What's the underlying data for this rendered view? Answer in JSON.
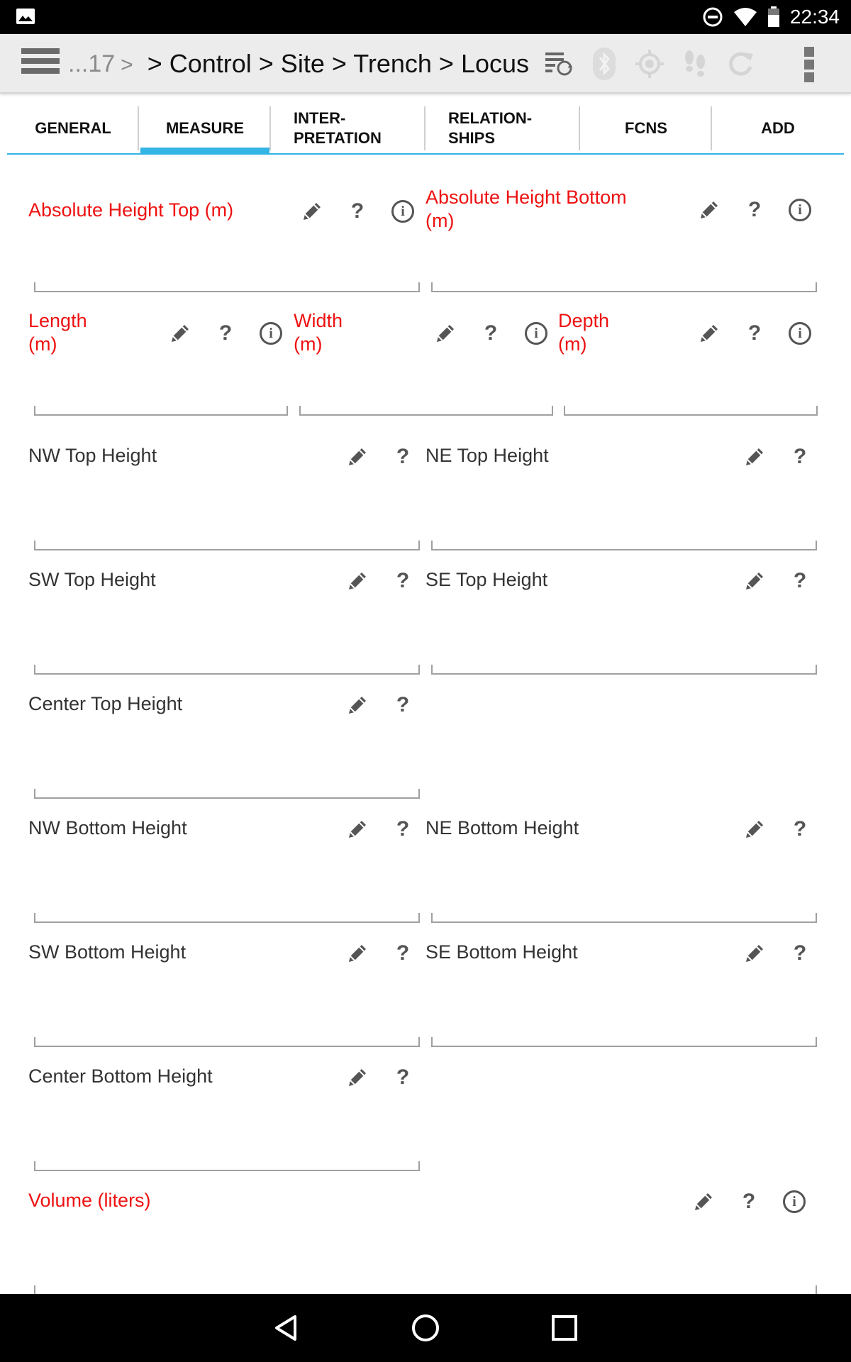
{
  "status_bar": {
    "time": "22:34",
    "icons": [
      "image-icon",
      "do-not-disturb-icon",
      "wifi-icon",
      "battery-icon"
    ]
  },
  "action_bar": {
    "breadcrumb_prefix": "...17",
    "breadcrumb_prefix_sep": ">",
    "breadcrumb_path": "> Control > Site > Trench > Locus",
    "icons": [
      "sync-list-icon",
      "bluetooth-icon",
      "gps-target-icon",
      "footsteps-icon",
      "refresh-icon",
      "overflow-menu-icon"
    ]
  },
  "tabs": [
    {
      "label": "GENERAL",
      "active": false
    },
    {
      "label": "MEASURE",
      "active": true
    },
    {
      "label": "INTER-\nPRETATION",
      "active": false
    },
    {
      "label": "RELATION-\nSHIPS",
      "active": false
    },
    {
      "label": "FCNS",
      "active": false
    },
    {
      "label": "ADD",
      "active": false
    }
  ],
  "fields": {
    "abs_height_top": {
      "label": "Absolute Height Top (m)",
      "value": ""
    },
    "abs_height_bottom": {
      "label": "Absolute Height Bottom\n(m)",
      "value": ""
    },
    "length": {
      "label": "Length\n(m)",
      "value": ""
    },
    "width": {
      "label": "Width\n(m)",
      "value": ""
    },
    "depth": {
      "label": "Depth\n(m)",
      "value": ""
    },
    "nw_top": {
      "label": "NW Top Height",
      "value": ""
    },
    "ne_top": {
      "label": "NE Top Height",
      "value": ""
    },
    "sw_top": {
      "label": "SW Top Height",
      "value": ""
    },
    "se_top": {
      "label": "SE Top Height",
      "value": ""
    },
    "center_top": {
      "label": "Center Top Height",
      "value": ""
    },
    "nw_bottom": {
      "label": "NW Bottom Height",
      "value": ""
    },
    "ne_bottom": {
      "label": "NE Bottom Height",
      "value": ""
    },
    "sw_bottom": {
      "label": "SW Bottom Height",
      "value": ""
    },
    "se_bottom": {
      "label": "SE Bottom Height",
      "value": ""
    },
    "center_bottom": {
      "label": "Center Bottom Height",
      "value": ""
    },
    "volume": {
      "label": "Volume (liters)",
      "value": ""
    }
  },
  "field_icons": {
    "help": "?",
    "info": "i"
  },
  "colors": {
    "required_label": "#ee1111",
    "tab_indicator": "#33b5e5"
  },
  "nav_bar": {
    "icons": [
      "back-icon",
      "home-icon",
      "recents-icon"
    ]
  }
}
